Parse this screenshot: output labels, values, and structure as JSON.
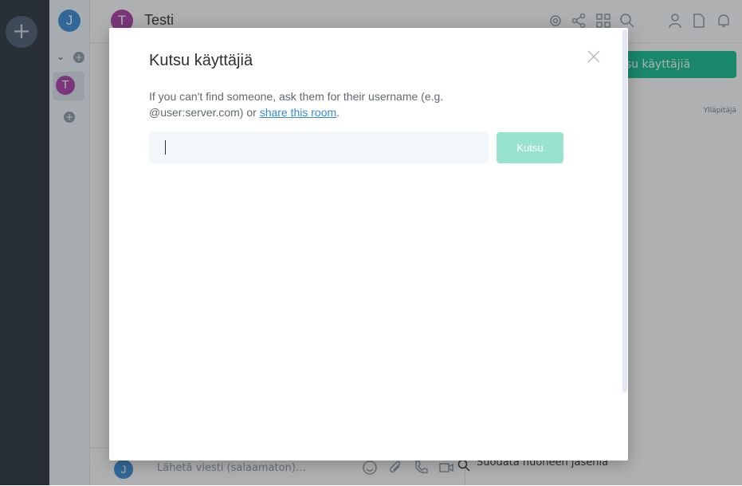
{
  "app": {
    "user_initial": "J",
    "room_initial": "T",
    "room_name": "Testi",
    "create_space_symbol": "+"
  },
  "right_panel": {
    "invite_button_label": "Kutsu käyttäjiä",
    "admin_label": "Ylläpitäjä",
    "filter_members_placeholder": "Suodata huoneen jäseniä"
  },
  "composer": {
    "user_initial": "J",
    "placeholder": "Lähetä viesti (salaamaton)…"
  },
  "dialog": {
    "title": "Kutsu käyttäjiä",
    "body_prefix": "If you can't find someone, ask them for their username (e.g. @user:server.com) or ",
    "body_link": "share this room",
    "body_suffix": ".",
    "input_value": "",
    "invite_button_label": "Kutsu"
  },
  "colors": {
    "accent": "#0dbd8b",
    "accent_disabled": "#98e3cd",
    "link": "#368bd6",
    "user_avatar": "#368bd6",
    "room_avatar": "#ac3ba8"
  },
  "icons": {
    "header": [
      "settings-icon",
      "share-icon",
      "grid-icon",
      "search-icon",
      "people-icon",
      "file-icon",
      "bell-icon"
    ],
    "composer": [
      "emoji-icon",
      "paperclip-icon",
      "voice-call-icon",
      "video-call-icon"
    ],
    "dialog": [
      "close-icon"
    ]
  }
}
